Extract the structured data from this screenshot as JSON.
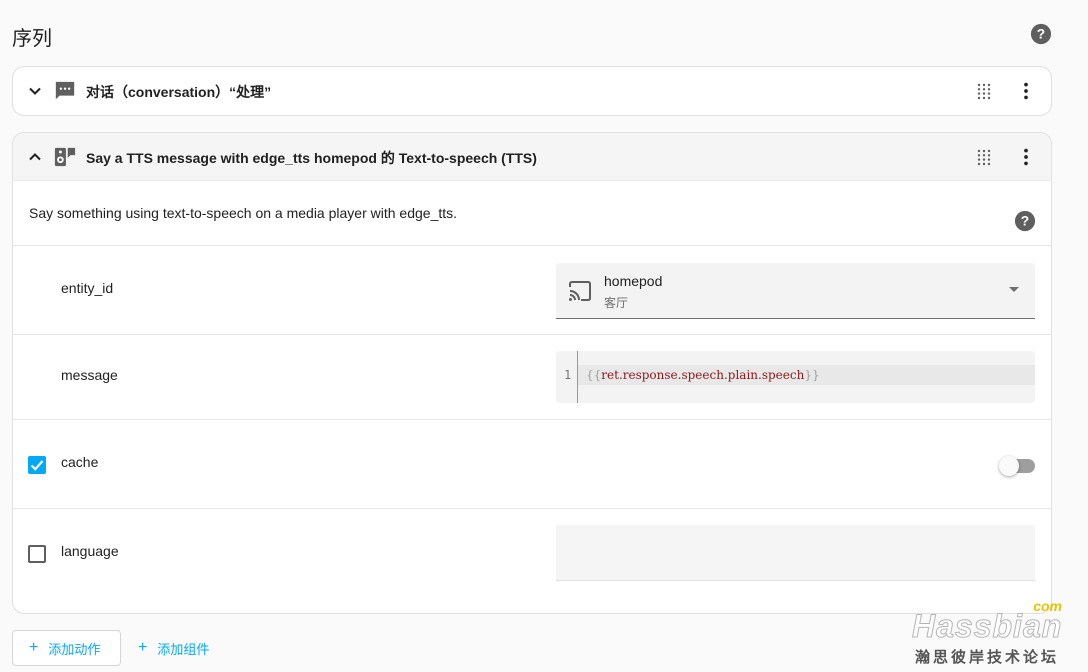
{
  "section": {
    "title": "序列"
  },
  "actions": [
    {
      "title": "对话（conversation）“处理”",
      "expanded": false
    },
    {
      "title": "Say a TTS message with edge_tts homepod 的 Text-to-speech (TTS)",
      "expanded": true,
      "description": "Say something using text-to-speech on a media player with edge_tts.",
      "fields": {
        "entity_id": {
          "label": "entity_id",
          "value": "homepod",
          "sub": "客厅"
        },
        "message": {
          "label": "message",
          "line_number": "1",
          "code_open": "{{",
          "code_body": "ret.response.speech.plain.speech",
          "code_close": "}}"
        },
        "cache": {
          "label": "cache",
          "checked": true,
          "toggle_on": false
        },
        "language": {
          "label": "language",
          "checked": false
        }
      }
    }
  ],
  "buttons": {
    "add_action": "添加动作",
    "add_block": "添加组件"
  },
  "watermark": {
    "com": "com",
    "main": "Hassbian",
    "sub": "瀚思彼岸技术论坛"
  },
  "colors": {
    "accent": "#03a9f4",
    "icon": "#5f5f5f"
  },
  "icons": {
    "help": "help-circle-icon",
    "collapse": "chevron-down-icon",
    "expand": "chevron-up-icon",
    "conversation": "message-processing-icon",
    "tts": "speaker-message-icon",
    "drag": "drag-handle-icon",
    "menu": "dots-vertical-icon",
    "cast": "cast-icon"
  }
}
